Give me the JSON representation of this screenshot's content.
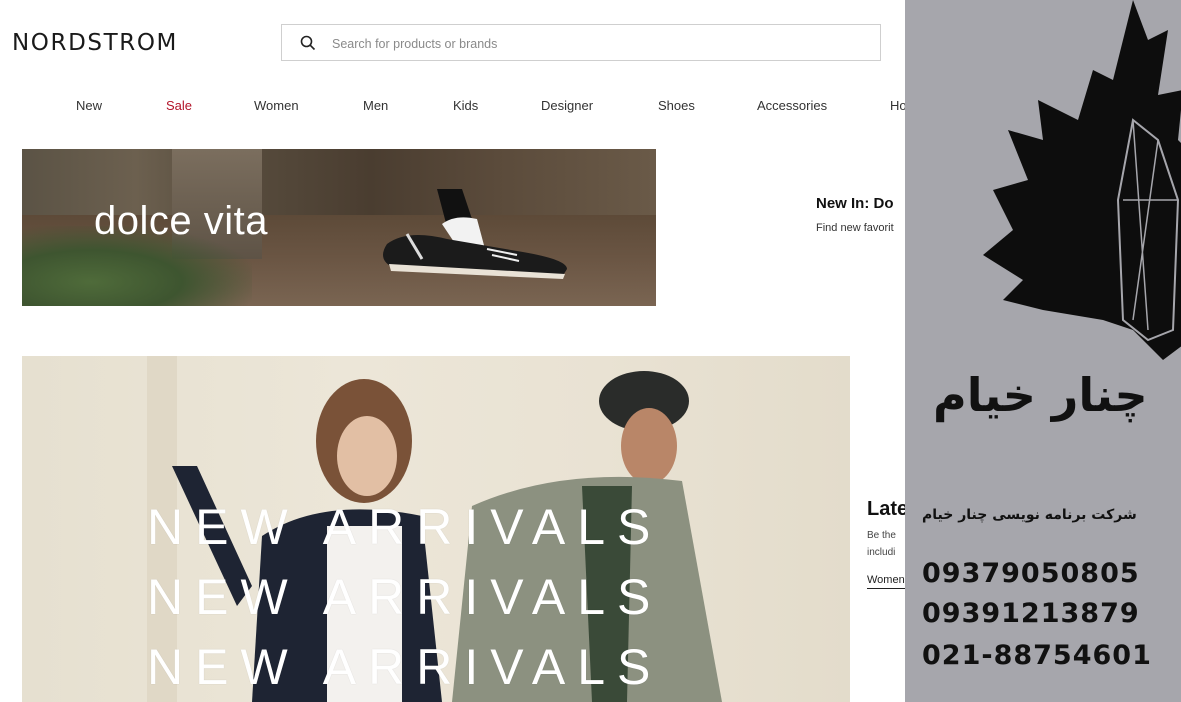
{
  "header": {
    "logo": "NORDSTROM",
    "search_placeholder": "Search for products or brands"
  },
  "nav": {
    "items": [
      "New",
      "Sale",
      "Women",
      "Men",
      "Kids",
      "Designer",
      "Shoes",
      "Accessories",
      "Ho"
    ],
    "accent_color": "#b3142a"
  },
  "hero_banner": {
    "caption": "dolce vita"
  },
  "promo_one": {
    "title": "New In: Do",
    "subtitle": "Find new favorit"
  },
  "new_arrivals": {
    "lines": [
      "NEW ARRIVALS",
      "NEW ARRIVALS",
      "NEW ARRIVALS"
    ]
  },
  "promo_two": {
    "title": "Late",
    "line1": "Be the",
    "line2": "includi",
    "link": "Women"
  },
  "ad_panel": {
    "brand": "چنار خیام",
    "tagline": "شرکت برنامه نویسی چنار خیام",
    "phones": [
      "09379050805",
      "09391213879",
      "021-88754601"
    ],
    "background": "#a6a6ac",
    "logo_icon": "maple-leaf-icon"
  }
}
